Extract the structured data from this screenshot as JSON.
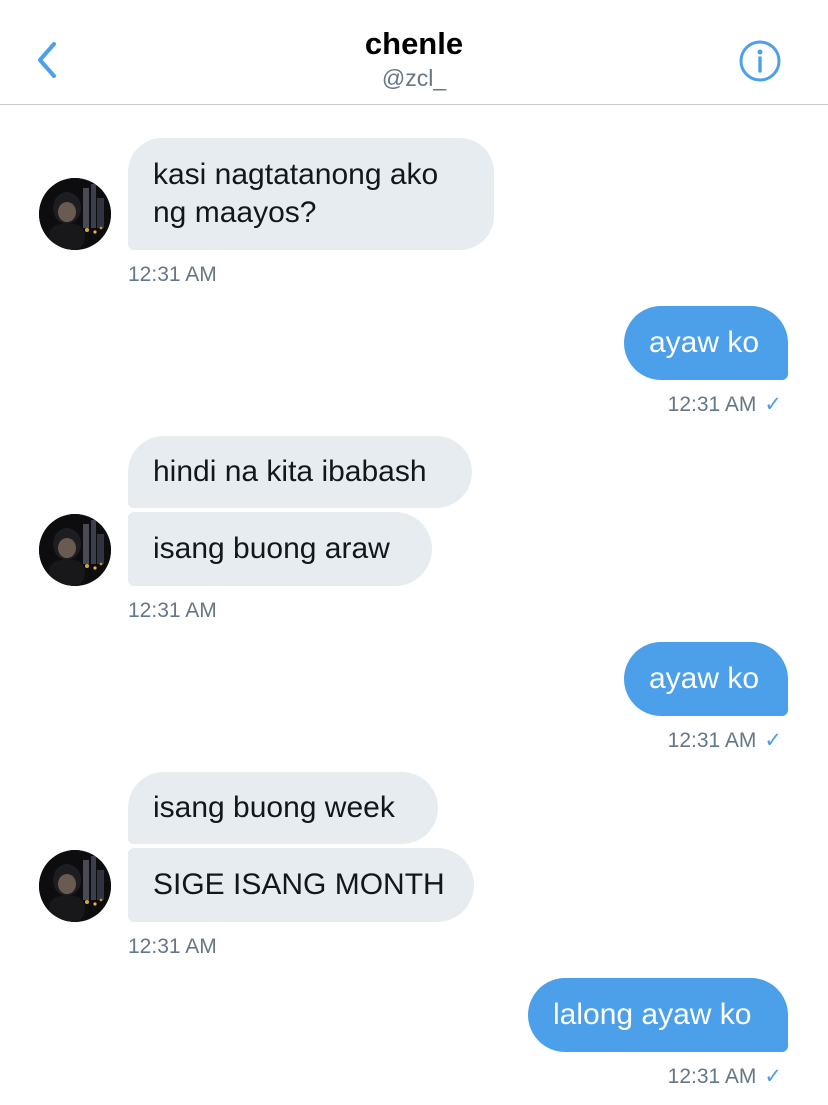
{
  "header": {
    "title": "chenle",
    "handle": "@zcl_"
  },
  "icons": {
    "back": "chevron-left-icon",
    "info": "info-circle-icon",
    "read_check": "checkmark-icon"
  },
  "colors": {
    "accent": "#4ca0ea",
    "incoming_bubble": "#e6ecf0",
    "timestamp": "#657786"
  },
  "messages": [
    {
      "direction": "in",
      "lines": [
        "kasi nagtatanong ako",
        "ng maayos?"
      ],
      "time": "12:31 AM"
    },
    {
      "direction": "out",
      "text": "ayaw ko",
      "time": "12:31 AM",
      "check": "✓"
    },
    {
      "direction": "in",
      "text": "hindi na kita ibabash"
    },
    {
      "direction": "in",
      "text": "isang buong araw",
      "time": "12:31 AM"
    },
    {
      "direction": "out",
      "text": "ayaw ko",
      "time": "12:31 AM",
      "check": "✓"
    },
    {
      "direction": "in",
      "text": "isang buong week"
    },
    {
      "direction": "in",
      "text": "SIGE ISANG MONTH",
      "time": "12:31 AM"
    },
    {
      "direction": "out",
      "text": "lalong ayaw ko",
      "time": "12:31 AM",
      "check": "✓"
    }
  ]
}
